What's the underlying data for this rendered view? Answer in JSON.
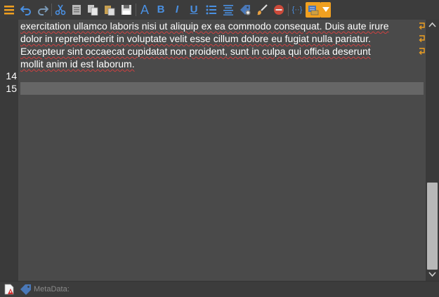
{
  "toolbar": {
    "buttons": [
      {
        "name": "menu",
        "icon": "hamburger-menu-icon"
      },
      {
        "name": "undo",
        "icon": "undo-icon"
      },
      {
        "name": "redo",
        "icon": "redo-icon"
      },
      {
        "name": "cut",
        "icon": "scissors-icon"
      },
      {
        "name": "copy",
        "icon": "copy-icon"
      },
      {
        "name": "paste",
        "icon": "paste-icon"
      },
      {
        "name": "paste-special",
        "icon": "paste-special-icon"
      },
      {
        "name": "save",
        "icon": "save-icon"
      },
      {
        "name": "font",
        "icon": "font-icon",
        "glyph": "A"
      },
      {
        "name": "bold",
        "icon": "bold-icon",
        "glyph": "B"
      },
      {
        "name": "italic",
        "icon": "italic-icon",
        "glyph": "I"
      },
      {
        "name": "underline",
        "icon": "underline-icon",
        "glyph": "U"
      },
      {
        "name": "bulleted-list",
        "icon": "bulleted-list-icon"
      },
      {
        "name": "align-center",
        "icon": "align-center-icon"
      },
      {
        "name": "insert-tag",
        "icon": "tag-add-icon"
      },
      {
        "name": "format-painter",
        "icon": "paintbrush-icon"
      },
      {
        "name": "remove",
        "icon": "remove-circle-icon"
      },
      {
        "name": "code",
        "icon": "braces-icon",
        "glyph": "{··}"
      },
      {
        "name": "preview",
        "icon": "preview-toggle-icon"
      },
      {
        "name": "preview-options",
        "icon": "chevron-down-icon"
      }
    ],
    "accent_color": "#f0a020",
    "icon_color": "#4a90e2"
  },
  "editor": {
    "lines": [
      "exercitation ullamco laboris nisi ut aliquip ex ea commodo consequat. Duis aute irure",
      "dolor in reprehenderit in voluptate velit esse cillum dolore eu fugiat nulla pariatur.",
      "Excepteur sint occaecat cupidatat non proident, sunt in culpa qui officia deserunt",
      "mollit anim id est laborum."
    ],
    "line_numbers": [
      "14",
      "15"
    ],
    "spellcheck_color": "#d04040",
    "wrap_indicator_color": "#f0a020"
  },
  "statusbar": {
    "metadata_label": "MetaData:"
  }
}
